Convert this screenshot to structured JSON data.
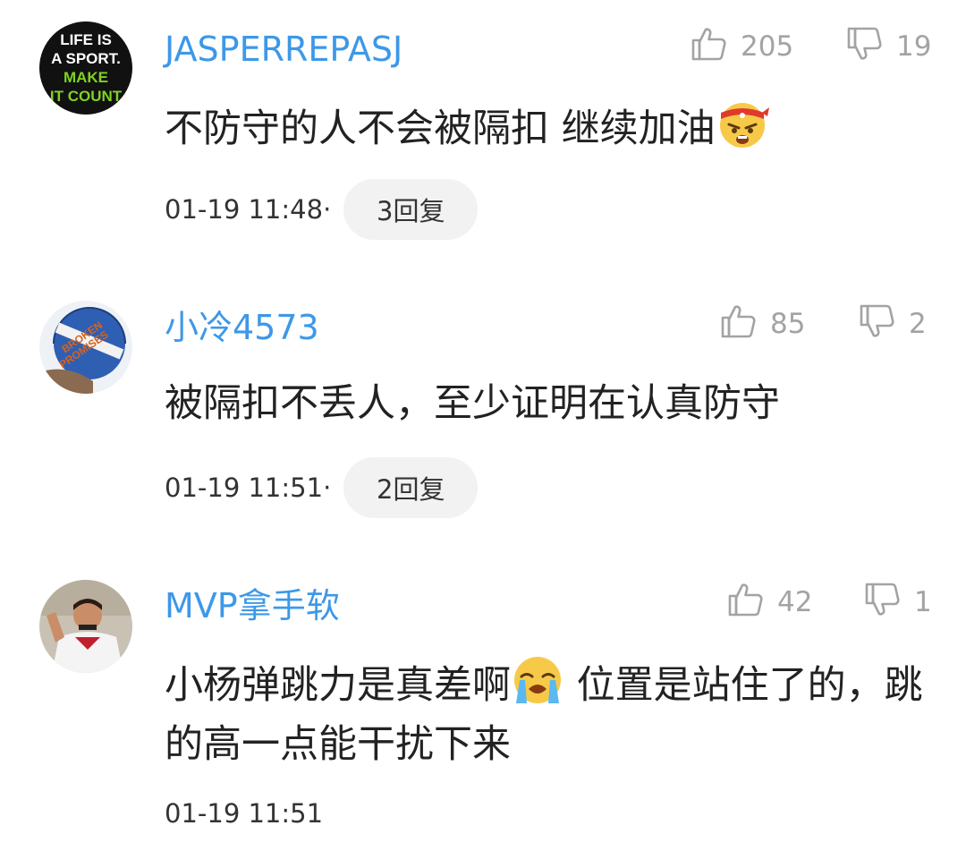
{
  "comments": [
    {
      "username": "JASPERREPASJ",
      "likes": "205",
      "dislikes": "19",
      "text_before_emoji": "不防守的人不会被隔扣 继续加油",
      "emoji": "angry-headband-emoji",
      "time": "01-19 11:48",
      "separator": "·",
      "replies": "3回复",
      "avatar_text": [
        "LIFE IS",
        "A SPORT.",
        "MAKE",
        "IT COUNT"
      ]
    },
    {
      "username": "小冷4573",
      "likes": "85",
      "dislikes": "2",
      "text": "被隔扣不丢人，至少证明在认真防守",
      "time": "01-19 11:51",
      "separator": "·",
      "replies": "2回复",
      "avatar_text": [
        "BROKEN",
        "PROMISES"
      ]
    },
    {
      "username": "MVP拿手软",
      "likes": "42",
      "dislikes": "1",
      "text_before_emoji": "小杨弹跳力是真差啊",
      "emoji": "crying-emoji",
      "text_after_emoji": " 位置是站住了的，跳的高一点能干扰下来",
      "time": "01-19 11:51"
    }
  ],
  "icons": {
    "like": "thumbs-up-outline-icon",
    "dislike": "thumbs-down-outline-icon"
  },
  "colors": {
    "username": "#3d98e8",
    "count": "#a3a3a3",
    "reply_bg": "#f2f2f2"
  }
}
